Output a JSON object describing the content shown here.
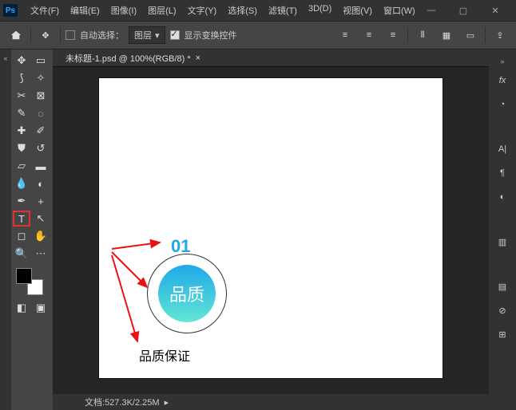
{
  "app": {
    "logo": "Ps"
  },
  "menu": [
    "文件(F)",
    "编辑(E)",
    "图像(I)",
    "图层(L)",
    "文字(Y)",
    "选择(S)",
    "滤镜(T)",
    "3D(D)",
    "视图(V)",
    "窗口(W)"
  ],
  "optbar": {
    "auto_select": "自动选择：",
    "dropdown": "图层",
    "show_controls": "显示变换控件"
  },
  "document": {
    "tab": "未标题-1.psd @ 100%(RGB/8) *"
  },
  "canvas": {
    "number": "01",
    "badge": "品质",
    "caption": "品质保证"
  },
  "status": {
    "doc": "文档:527.3K/2.25M"
  },
  "tools_left": [
    "move",
    "marquee",
    "lasso",
    "wand",
    "crop",
    "frame",
    "eyedrop",
    "ellipse-marquee",
    "heal",
    "brush",
    "stamp",
    "eraser",
    "gradient",
    "blur",
    "dodge",
    "pen",
    "type",
    "path",
    "rect",
    "hand",
    "zoom",
    "dots"
  ],
  "right_icons": [
    "fx",
    "color",
    "char",
    "para",
    "brushset",
    "swatches",
    "layers",
    "adjust",
    "props"
  ]
}
